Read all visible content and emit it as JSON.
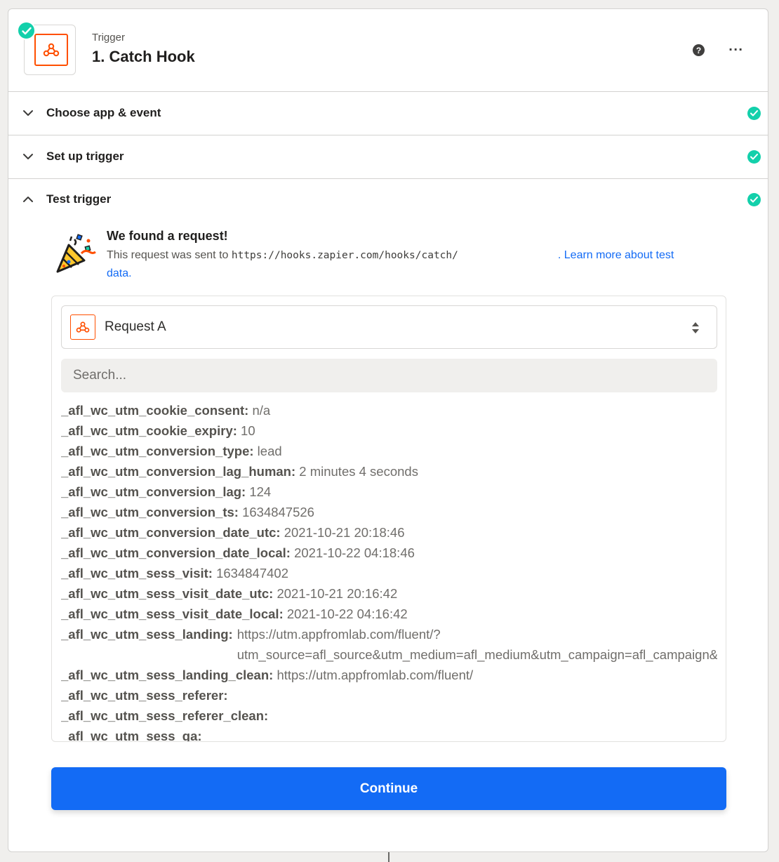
{
  "header": {
    "kicker": "Trigger",
    "title": "1. Catch Hook",
    "help_glyph": "?",
    "more_glyph": "···"
  },
  "sections": [
    {
      "label": "Choose app & event",
      "expanded": false,
      "complete": true
    },
    {
      "label": "Set up trigger",
      "expanded": false,
      "complete": true
    },
    {
      "label": "Test trigger",
      "expanded": true,
      "complete": true
    }
  ],
  "found": {
    "title": "We found a request!",
    "desc_prefix": "This request was sent to ",
    "url": "https://hooks.zapier.com/hooks/catch/",
    "link_text": ". Learn more about test",
    "link_text2": "data."
  },
  "request_select": {
    "value": "Request A"
  },
  "search": {
    "placeholder": "Search..."
  },
  "fields": [
    {
      "key": "_afl_wc_utm_cookie_consent:",
      "value": "n/a"
    },
    {
      "key": "_afl_wc_utm_cookie_expiry:",
      "value": "10"
    },
    {
      "key": "_afl_wc_utm_conversion_type:",
      "value": "lead"
    },
    {
      "key": "_afl_wc_utm_conversion_lag_human:",
      "value": "2 minutes 4 seconds"
    },
    {
      "key": "_afl_wc_utm_conversion_lag:",
      "value": "124"
    },
    {
      "key": "_afl_wc_utm_conversion_ts:",
      "value": "1634847526"
    },
    {
      "key": "_afl_wc_utm_conversion_date_utc:",
      "value": "2021-10-21 20:18:46"
    },
    {
      "key": "_afl_wc_utm_conversion_date_local:",
      "value": "2021-10-22 04:18:46"
    },
    {
      "key": "_afl_wc_utm_sess_visit:",
      "value": "1634847402"
    },
    {
      "key": "_afl_wc_utm_sess_visit_date_utc:",
      "value": "2021-10-21 20:16:42"
    },
    {
      "key": "_afl_wc_utm_sess_visit_date_local:",
      "value": "2021-10-22 04:16:42"
    },
    {
      "key": "_afl_wc_utm_sess_landing:",
      "value": "https://utm.appfromlab.com/fluent/?\nutm_source=afl_source&utm_medium=afl_medium&utm_campaign=afl_campaign&",
      "multi": true
    },
    {
      "key": "_afl_wc_utm_sess_landing_clean:",
      "value": "https://utm.appfromlab.com/fluent/"
    },
    {
      "key": "_afl_wc_utm_sess_referer:",
      "value": ""
    },
    {
      "key": "_afl_wc_utm_sess_referer_clean:",
      "value": ""
    },
    {
      "key": "_afl_wc_utm_sess_ga:",
      "value": ""
    }
  ],
  "continue_button": {
    "label": "Continue"
  },
  "colors": {
    "accent": "#136bf5",
    "success": "#13d0ab",
    "brand": "#ff4f00"
  }
}
